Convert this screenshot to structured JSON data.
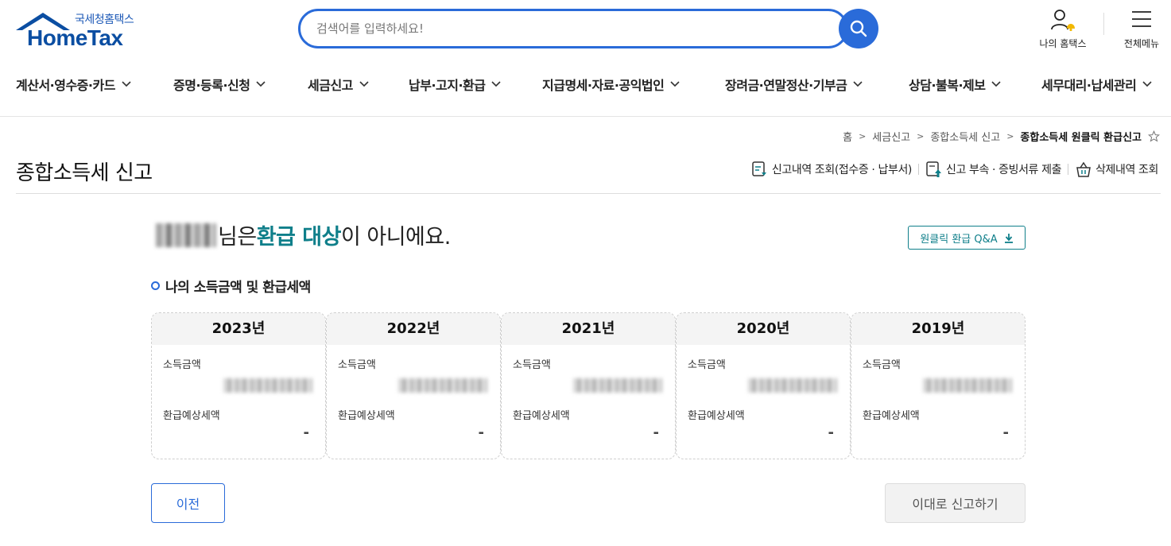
{
  "header": {
    "logo_sub": "국세청홈택스",
    "logo_main": "HomeTax",
    "search_placeholder": "검색어를 입력하세요!",
    "my_hometax": "나의 홈택스",
    "all_menu": "전체메뉴"
  },
  "gnb": [
    {
      "label": "계산서·영수증·카드"
    },
    {
      "label": "증명·등록·신청"
    },
    {
      "label": "세금신고"
    },
    {
      "label": "납부·고지·환급"
    },
    {
      "label": "지급명세·자료·공익법인"
    },
    {
      "label": "장려금·연말정산·기부금"
    },
    {
      "label": "상담·불복·제보"
    },
    {
      "label": "세무대리·납세관리"
    }
  ],
  "breadcrumb": [
    "홈",
    "세금신고",
    "종합소득세 신고",
    "종합소득세 원클릭 환급신고"
  ],
  "page_title": "종합소득세 신고",
  "top_links": [
    "신고내역 조회(접수증 · 납부서)",
    "신고 부속 · 증빙서류 제출",
    "삭제내역 조회"
  ],
  "headline": {
    "suffix_pre": "님은 ",
    "emphasis": "환급 대상",
    "suffix_post": "이 아니에요."
  },
  "qa_button": "원클릭 환급 Q&A",
  "section_title": "나의 소득금액 및 환급세액",
  "cards": [
    {
      "year": "2023년",
      "income_label": "소득금액",
      "refund_label": "환급예상세액",
      "refund_value": "-"
    },
    {
      "year": "2022년",
      "income_label": "소득금액",
      "refund_label": "환급예상세액",
      "refund_value": "-"
    },
    {
      "year": "2021년",
      "income_label": "소득금액",
      "refund_label": "환급예상세액",
      "refund_value": "-"
    },
    {
      "year": "2020년",
      "income_label": "소득금액",
      "refund_label": "환급예상세액",
      "refund_value": "-"
    },
    {
      "year": "2019년",
      "income_label": "소득금액",
      "refund_label": "환급예상세액",
      "refund_value": "-"
    }
  ],
  "buttons": {
    "prev": "이전",
    "submit": "이대로 신고하기"
  },
  "colors": {
    "brand_blue": "#2a6bd9",
    "logo_blue": "#0b4ea2",
    "accent_teal": "#0f7f8a"
  }
}
